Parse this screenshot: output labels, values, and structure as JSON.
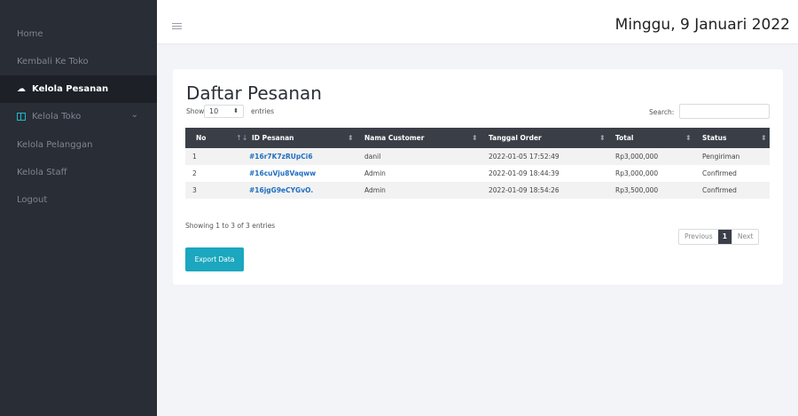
{
  "sidebar": {
    "items": [
      {
        "label": "Home"
      },
      {
        "label": "Kembali Ke Toko"
      },
      {
        "label": "Kelola Pesanan"
      },
      {
        "label": "Kelola Toko"
      },
      {
        "label": "Kelola Pelanggan"
      },
      {
        "label": "Kelola Staff"
      },
      {
        "label": "Logout"
      }
    ],
    "active_index": 2,
    "accent_color": "#1eb8c7"
  },
  "header": {
    "date": "Minggu, 9 Januari 2022"
  },
  "page": {
    "title": "Daftar Pesanan",
    "show_label": "Show",
    "page_length": "10",
    "entries_label": "entries",
    "search_label": "Search:",
    "search_value": ""
  },
  "table": {
    "columns": [
      "No",
      "ID Pesanan",
      "Nama Customer",
      "Tanggal Order",
      "Total",
      "Status"
    ],
    "rows": [
      {
        "no": "1",
        "id": "#16r7K7zRUpCi6",
        "customer": "danil",
        "date": "2022-01-05 17:52:49",
        "total": "Rp3,000,000",
        "status": "Pengiriman"
      },
      {
        "no": "2",
        "id": "#16cuVju8Vaqww",
        "customer": "Admin",
        "date": "2022-01-09 18:44:39",
        "total": "Rp3,000,000",
        "status": "Confirmed"
      },
      {
        "no": "3",
        "id": "#16jgG9eCYGvO.",
        "customer": "Admin",
        "date": "2022-01-09 18:54:26",
        "total": "Rp3,500,000",
        "status": "Confirmed"
      }
    ],
    "info": "Showing 1 to 3 of 3 entries"
  },
  "pagination": {
    "previous": "Previous",
    "current": "1",
    "next": "Next"
  },
  "actions": {
    "export": "Export Data"
  },
  "colors": {
    "sidebar_bg": "#292d36",
    "table_header_bg": "#3a3f47",
    "link": "#1f6ec0",
    "export_button": "#1ba7bf"
  }
}
